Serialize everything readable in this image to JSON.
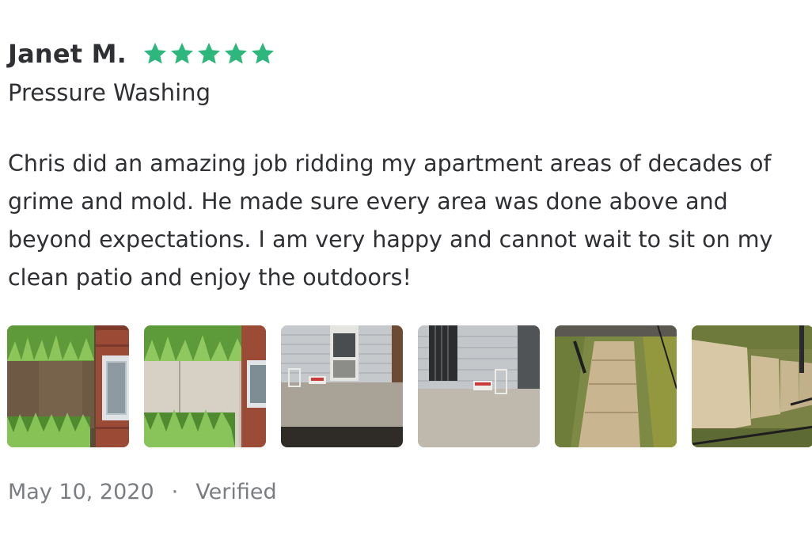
{
  "review": {
    "reviewer_name": "Janet M.",
    "rating": 5,
    "rating_max": 5,
    "star_color": "#2db77c",
    "service": "Pressure Washing",
    "text": "Chris did an amazing job ridding my apartment areas of decades of grime and mold. He made sure every area was done above and beyond expectations. I am very happy and cannot wait to sit on my clean patio and enjoy the outdoors!",
    "date": "May 10, 2020",
    "separator": "·",
    "status": "Verified"
  },
  "photos": [
    {
      "subject": "walkway-before"
    },
    {
      "subject": "walkway-after"
    },
    {
      "subject": "patio-door"
    },
    {
      "subject": "patio-door-side"
    },
    {
      "subject": "concrete-steps"
    },
    {
      "subject": "concrete-steps-side"
    }
  ]
}
